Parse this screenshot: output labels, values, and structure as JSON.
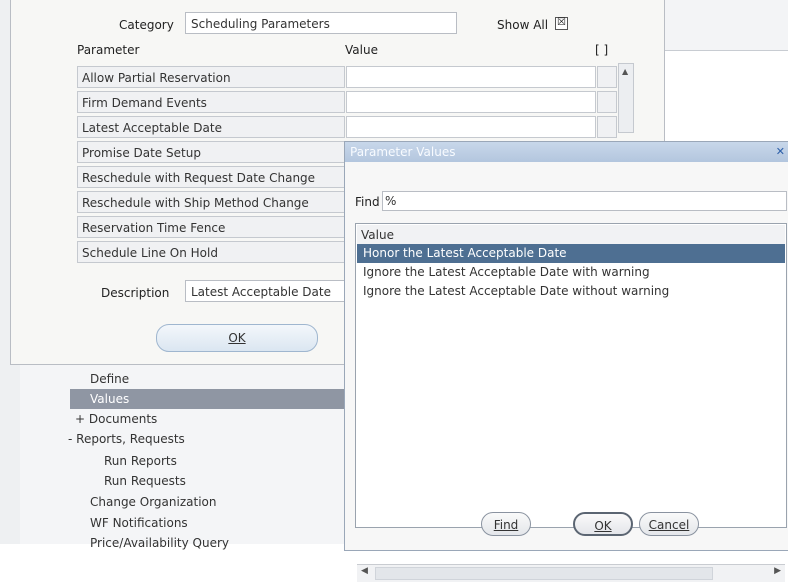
{
  "navigator": {
    "items": [
      {
        "label": "Define"
      },
      {
        "label": "Values"
      },
      {
        "label": "+  Documents"
      },
      {
        "label": "-  Reports, Requests"
      },
      {
        "label": "Run Reports"
      },
      {
        "label": "Run Requests"
      },
      {
        "label": "Change Organization"
      },
      {
        "label": "WF Notifications"
      },
      {
        "label": "Price/Availability Query"
      }
    ]
  },
  "main_window": {
    "category_label": "Category",
    "category_value": "Scheduling Parameters",
    "show_all_label": "Show All",
    "show_all_checked": "☒",
    "column_parameter": "Parameter",
    "column_value": "Value",
    "column_edit": "[ ]",
    "parameters": [
      {
        "name": "Allow Partial Reservation"
      },
      {
        "name": "Firm Demand Events"
      },
      {
        "name": "Latest Acceptable Date"
      },
      {
        "name": "Promise Date Setup"
      },
      {
        "name": "Reschedule with Request Date Change"
      },
      {
        "name": "Reschedule with Ship Method Change"
      },
      {
        "name": "Reservation Time Fence"
      },
      {
        "name": "Schedule Line On Hold"
      }
    ],
    "description_label": "Description",
    "description_value": "Latest Acceptable Date",
    "ok_label": "OK"
  },
  "dialog": {
    "title": "Parameter Values",
    "close_glyph": "✕",
    "find_label": "Find",
    "find_value": "%",
    "list_header": "Value",
    "values": [
      {
        "label": "Honor the Latest Acceptable Date",
        "selected": true
      },
      {
        "label": "Ignore the Latest Acceptable Date with warning",
        "selected": false
      },
      {
        "label": "Ignore the Latest Acceptable Date without warning",
        "selected": false
      }
    ],
    "find_button": "Find",
    "ok_button": "OK",
    "cancel_button": "Cancel"
  },
  "colors": {
    "selection": "#4e6f92",
    "tree_selection": "#8f96a3",
    "titlebar": "#b3c6de"
  }
}
